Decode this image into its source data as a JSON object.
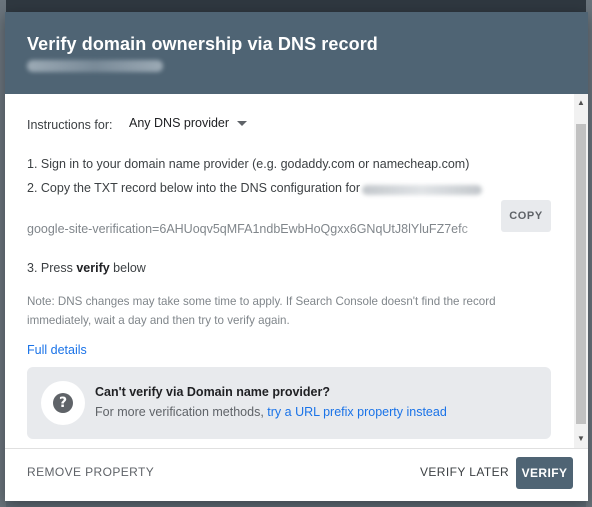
{
  "dialog": {
    "title": "Verify domain ownership via DNS record"
  },
  "instructions": {
    "label": "Instructions for:",
    "provider": "Any DNS provider"
  },
  "steps": {
    "step1": "1. Sign in to your domain name provider (e.g. godaddy.com or namecheap.com)",
    "step2": "2. Copy the TXT record below into the DNS configuration for",
    "txt_record": "google-site-verification=6AHUoqv5qMFA1ndbEwbHoQgxx6GNqUtJ8lYluFZ7efc",
    "copy_label": "COPY",
    "step3_prefix": "3. Press ",
    "step3_bold": "verify",
    "step3_suffix": " below"
  },
  "note": "Note: DNS changes may take some time to apply. If Search Console doesn't find the record immediately, wait a day and then try to verify again.",
  "full_details": "Full details",
  "info_box": {
    "title": "Can't verify via Domain name provider?",
    "text_prefix": "For more verification methods, ",
    "link": "try a URL prefix property instead"
  },
  "footer": {
    "remove": "REMOVE PROPERTY",
    "verify_later": "VERIFY LATER",
    "verify": "VERIFY"
  },
  "colors": {
    "header": "#4f6474",
    "link": "#1a73e8",
    "info_bg": "#e8eaed"
  }
}
